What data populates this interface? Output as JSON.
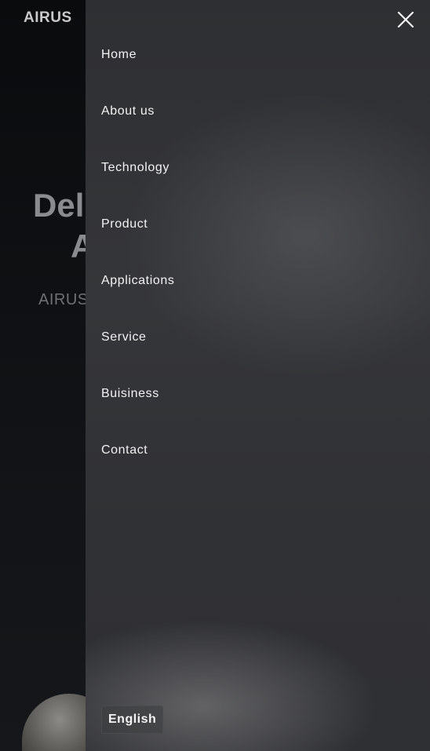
{
  "background_page": {
    "logo": "AIRUS",
    "hero_title_line1": "Del",
    "hero_title_line2": "A",
    "hero_subtitle": "AIRUS"
  },
  "drawer": {
    "close_icon": "close-icon",
    "menu_items": [
      {
        "label": "Home"
      },
      {
        "label": "About us"
      },
      {
        "label": "Technology"
      },
      {
        "label": "Product"
      },
      {
        "label": "Applications"
      },
      {
        "label": "Service"
      },
      {
        "label": "Buisiness"
      },
      {
        "label": "Contact"
      }
    ],
    "language_button": "English"
  },
  "colors": {
    "drawer_background": "#333437",
    "menu_text": "#f2f2f3",
    "page_background": "#0b0c0e"
  }
}
